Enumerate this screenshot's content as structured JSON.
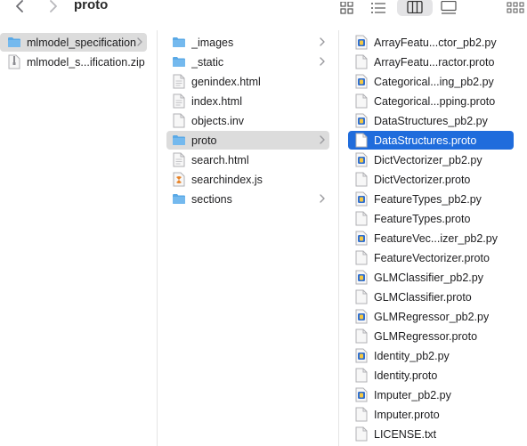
{
  "toolbar": {
    "title": "proto"
  },
  "column1": {
    "items": [
      {
        "label": "mlmodel_specification",
        "icon": "folder-icon",
        "selected": "gray",
        "chevron": true
      },
      {
        "label": "mlmodel_s...ification.zip",
        "icon": "zip-icon",
        "selected": "",
        "chevron": false
      }
    ]
  },
  "column2": {
    "items": [
      {
        "label": "_images",
        "icon": "folder-icon",
        "chevron": true
      },
      {
        "label": "_static",
        "icon": "folder-icon",
        "chevron": true
      },
      {
        "label": "genindex.html",
        "icon": "html-file-icon"
      },
      {
        "label": "index.html",
        "icon": "html-file-icon"
      },
      {
        "label": "objects.inv",
        "icon": "document-icon"
      },
      {
        "label": "proto",
        "icon": "folder-icon",
        "chevron": true,
        "selected": "gray"
      },
      {
        "label": "search.html",
        "icon": "html-file-icon"
      },
      {
        "label": "searchindex.js",
        "icon": "js-file-icon"
      },
      {
        "label": "sections",
        "icon": "folder-icon",
        "chevron": true
      }
    ]
  },
  "column3": {
    "items": [
      {
        "label": "ArrayFeatu...ctor_pb2.py",
        "icon": "python-file-icon"
      },
      {
        "label": "ArrayFeatu...ractor.proto",
        "icon": "document-icon"
      },
      {
        "label": "Categorical...ing_pb2.py",
        "icon": "python-file-icon"
      },
      {
        "label": "Categorical...pping.proto",
        "icon": "document-icon"
      },
      {
        "label": "DataStructures_pb2.py",
        "icon": "python-file-icon"
      },
      {
        "label": "DataStructures.proto",
        "icon": "document-icon",
        "selected": "blue"
      },
      {
        "label": "DictVectorizer_pb2.py",
        "icon": "python-file-icon"
      },
      {
        "label": "DictVectorizer.proto",
        "icon": "document-icon"
      },
      {
        "label": "FeatureTypes_pb2.py",
        "icon": "python-file-icon"
      },
      {
        "label": "FeatureTypes.proto",
        "icon": "document-icon"
      },
      {
        "label": "FeatureVec...izer_pb2.py",
        "icon": "python-file-icon"
      },
      {
        "label": "FeatureVectorizer.proto",
        "icon": "document-icon"
      },
      {
        "label": "GLMClassifier_pb2.py",
        "icon": "python-file-icon"
      },
      {
        "label": "GLMClassifier.proto",
        "icon": "document-icon"
      },
      {
        "label": "GLMRegressor_pb2.py",
        "icon": "python-file-icon"
      },
      {
        "label": "GLMRegressor.proto",
        "icon": "document-icon"
      },
      {
        "label": "Identity_pb2.py",
        "icon": "python-file-icon"
      },
      {
        "label": "Identity.proto",
        "icon": "document-icon"
      },
      {
        "label": "Imputer_pb2.py",
        "icon": "python-file-icon"
      },
      {
        "label": "Imputer.proto",
        "icon": "document-icon"
      },
      {
        "label": "LICENSE.txt",
        "icon": "document-icon"
      }
    ]
  },
  "colors": {
    "selection_blue": "#1f6cdc",
    "selection_gray": "#dcdcdc",
    "folder_blue": "#5aa9e6",
    "python_blue": "#2f6fd1",
    "js_orange": "#e8842a"
  }
}
